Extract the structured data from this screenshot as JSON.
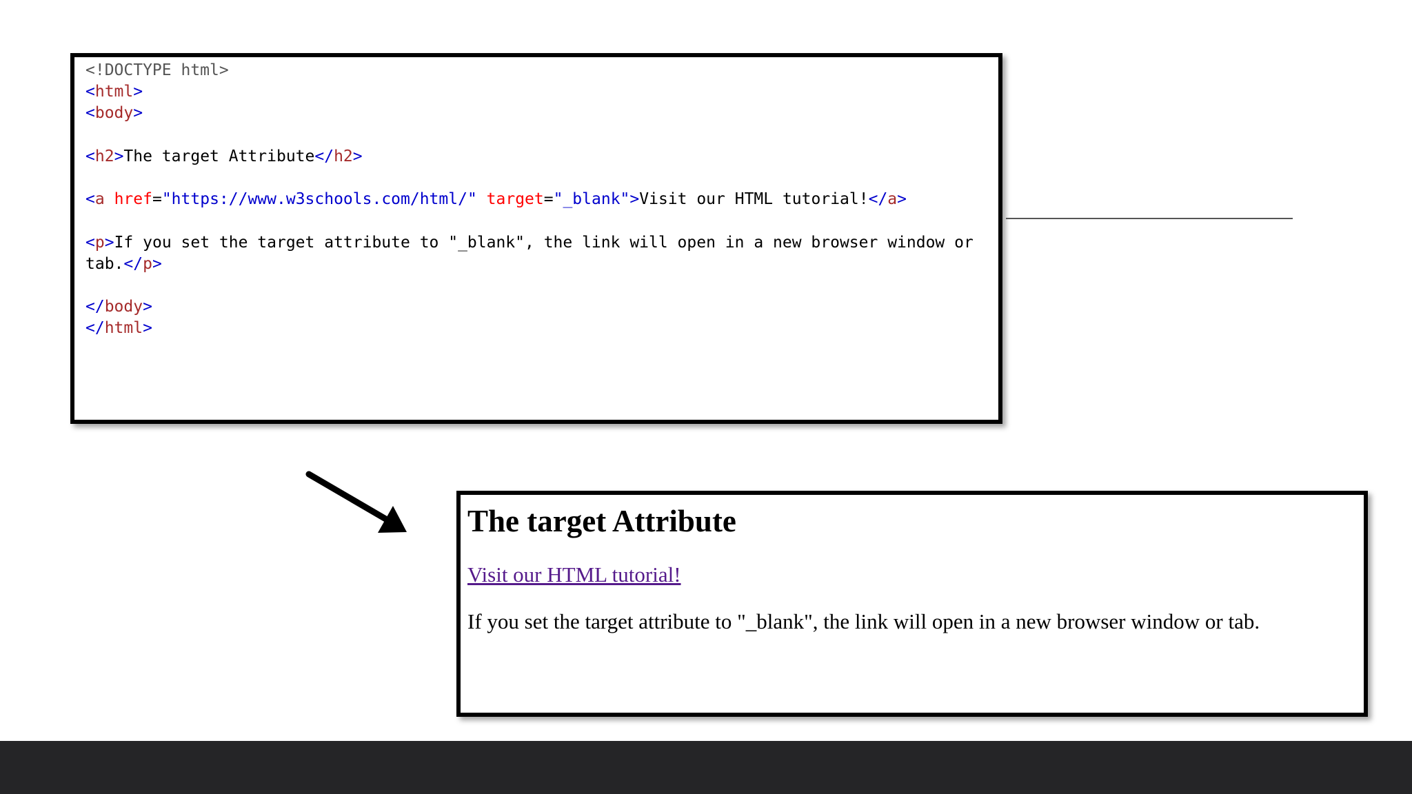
{
  "code": {
    "doctype": "<!DOCTYPE html>",
    "html_open": "html",
    "body_open": "body",
    "h2_tag": "h2",
    "h2_text": "The target Attribute",
    "a_tag": "a",
    "href_attr": "href",
    "href_value": "\"https://www.w3schools.com/html/\"",
    "target_attr": "target",
    "target_value": "\"_blank\"",
    "link_text": "Visit our HTML tutorial!",
    "p_tag": "p",
    "p_text_line1": "If you set the target attribute to \"_blank\", the link will open in a new browser window or",
    "p_text_line2": "tab.",
    "body_close": "body",
    "html_close": "html"
  },
  "result": {
    "title": "The target Attribute",
    "link_text": "Visit our HTML tutorial!",
    "paragraph": "If you set the target attribute to \"_blank\", the link will open in a new browser window or tab."
  },
  "colors": {
    "tag": "#a52a2a",
    "bracket": "#0000cd",
    "attr_name": "#ff0000",
    "attr_value": "#0000cd",
    "visited_link": "#551a8b",
    "footer": "#252527"
  }
}
